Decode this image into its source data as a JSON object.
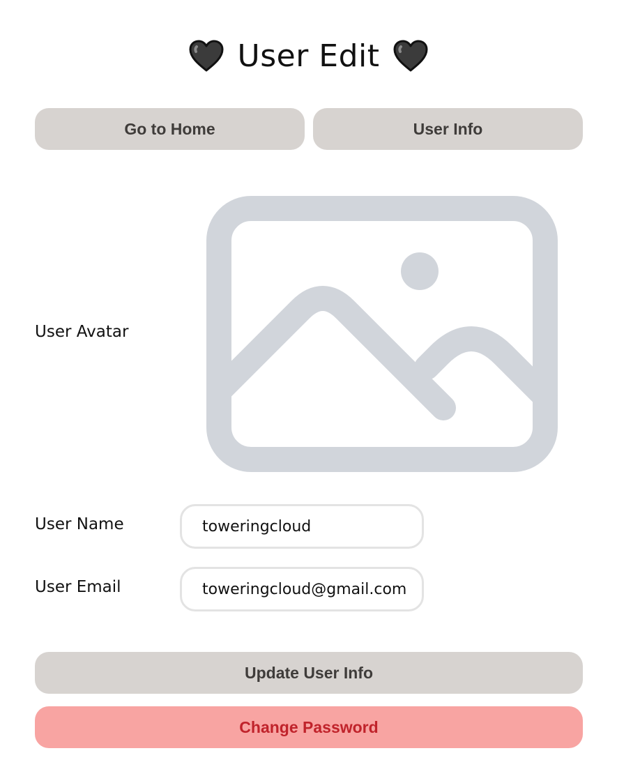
{
  "page": {
    "title": "User Edit",
    "title_icon": "black-heart-icon"
  },
  "nav": {
    "home_label": "Go to Home",
    "info_label": "User Info"
  },
  "form": {
    "avatar_label": "User Avatar",
    "avatar_icon": "image-placeholder-icon",
    "name_label": "User Name",
    "name_value": "toweringcloud",
    "email_label": "User Email",
    "email_value": "toweringcloud@gmail.com"
  },
  "actions": {
    "update_label": "Update User Info",
    "change_password_label": "Change Password"
  },
  "colors": {
    "button_bg": "#d7d3d0",
    "button_text": "#3f3c3a",
    "danger_bg": "#f8a4a2",
    "danger_text": "#c0232b",
    "placeholder_icon": "#d1d5db",
    "input_border": "#e3e3e3"
  }
}
